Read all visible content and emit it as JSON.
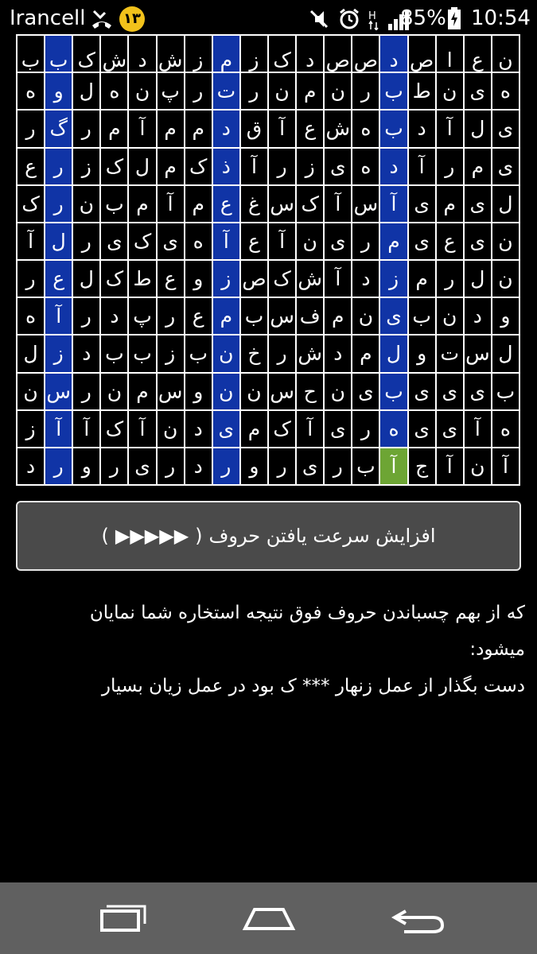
{
  "status_bar": {
    "carrier": "Irancell",
    "notification_count": "۱۳",
    "battery": "85%",
    "time": "10:54",
    "icons": [
      "missed-call-icon",
      "mute-icon",
      "alarm-icon",
      "data-h-icon",
      "signal-icon",
      "battery-charging-icon"
    ]
  },
  "grid": {
    "rows": [
      [
        "ن",
        "ع",
        "ا",
        "ص",
        "د",
        "ص",
        "ص",
        "د",
        "ک",
        "ز",
        "م",
        "ز",
        "ش",
        "د",
        "ش",
        "ک",
        "ب",
        "ب"
      ],
      [
        "ه",
        "ی",
        "ن",
        "ط",
        "ب",
        "ر",
        "ن",
        "م",
        "ن",
        "ر",
        "ت",
        "ر",
        "پ",
        "ن",
        "ه",
        "ل",
        "و",
        "ه"
      ],
      [
        "ی",
        "ل",
        "آ",
        "د",
        "ب",
        "ه",
        "ش",
        "ع",
        "آ",
        "ق",
        "د",
        "م",
        "م",
        "آ",
        "م",
        "ر",
        "گ",
        "ر"
      ],
      [
        "ی",
        "م",
        "ر",
        "آ",
        "د",
        "ه",
        "ی",
        "ز",
        "ر",
        "آ",
        "ذ",
        "ک",
        "م",
        "ل",
        "ک",
        "ز",
        "ر",
        "ع"
      ],
      [
        "ل",
        "ی",
        "م",
        "ی",
        "آ",
        "س",
        "آ",
        "ک",
        "س",
        "غ",
        "ع",
        "م",
        "آ",
        "م",
        "ب",
        "ن",
        "ر",
        "ک"
      ],
      [
        "ن",
        "ی",
        "ع",
        "ی",
        "م",
        "ر",
        "ی",
        "ن",
        "آ",
        "ع",
        "آ",
        "ه",
        "ی",
        "ک",
        "ی",
        "ر",
        "ل",
        "آ"
      ],
      [
        "ن",
        "ل",
        "ر",
        "م",
        "ز",
        "د",
        "آ",
        "ش",
        "ک",
        "ص",
        "ز",
        "و",
        "ع",
        "ط",
        "ک",
        "ل",
        "ع",
        "ر"
      ],
      [
        "و",
        "د",
        "ن",
        "ب",
        "ی",
        "ن",
        "م",
        "ف",
        "س",
        "ب",
        "م",
        "ع",
        "ر",
        "پ",
        "د",
        "ر",
        "آ",
        "ه"
      ],
      [
        "ل",
        "س",
        "ت",
        "و",
        "ل",
        "م",
        "د",
        "ش",
        "ر",
        "خ",
        "ن",
        "ب",
        "ز",
        "ب",
        "ب",
        "د",
        "ز",
        "ل"
      ],
      [
        "ب",
        "ی",
        "ی",
        "ی",
        "ب",
        "ی",
        "ن",
        "ح",
        "س",
        "ن",
        "ن",
        "و",
        "س",
        "م",
        "ن",
        "ر",
        "س",
        "ن"
      ],
      [
        "ه",
        "آ",
        "ی",
        "ی",
        "ه",
        "ر",
        "ی",
        "آ",
        "ک",
        "م",
        "ی",
        "د",
        "ن",
        "آ",
        "ک",
        "آ",
        "آ",
        "ز"
      ],
      [
        "آ",
        "ن",
        "آ",
        "ج",
        "آ",
        "ب",
        "ر",
        "ی",
        "ر",
        "و",
        "ر",
        "د",
        "ر",
        "ی",
        "ر",
        "و",
        "ر",
        "د"
      ]
    ],
    "highlighted_columns": [
      4,
      10,
      16
    ],
    "selected_cell": {
      "row": 11,
      "col": 4
    },
    "colors": {
      "highlight": "#1034a6",
      "selected": "#6da534",
      "cell_bg": "#000000",
      "border": "#ffffff"
    }
  },
  "speed_button": {
    "label": "افزایش سرعت یافتن حروف",
    "open": "(",
    "arrows": "▶▶▶▶▶",
    "close": ")"
  },
  "hint": {
    "line1": "که از بهم چسباندن حروف فوق نتیجه استخاره شما نمایان میشود:",
    "line2": "دست بگذار از عمل زنهار *** ک بود در عمل زیان بسیار"
  },
  "nav_bar": {
    "icons": [
      "recent-apps-icon",
      "home-icon",
      "back-icon"
    ]
  }
}
